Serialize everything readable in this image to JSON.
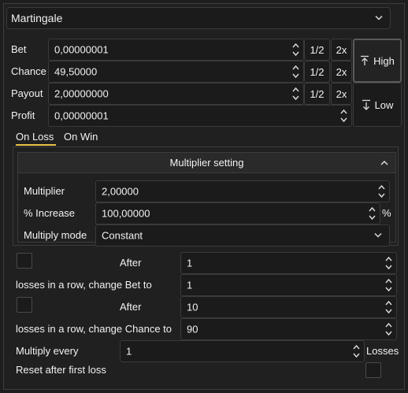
{
  "strategy": {
    "selected": "Martingale"
  },
  "bet": {
    "label": "Bet",
    "value": "0,00000001",
    "half": "1/2",
    "double": "2x"
  },
  "chance": {
    "label": "Chance",
    "value": "49,50000",
    "half": "1/2",
    "double": "2x"
  },
  "payout": {
    "label": "Payout",
    "value": "2,00000000",
    "half": "1/2",
    "double": "2x"
  },
  "profit": {
    "label": "Profit",
    "value": "0,00000001"
  },
  "high_button": {
    "label": "High"
  },
  "low_button": {
    "label": "Low"
  },
  "tabs": {
    "on_loss": "On Loss",
    "on_win": "On Win"
  },
  "multiplier_group": {
    "title": "Multiplier setting",
    "multiplier_label": "Multiplier",
    "multiplier_value": "2,00000",
    "increase_label": "% Increase",
    "increase_value": "100,00000",
    "increase_unit": "%",
    "mode_label": "Multiply mode",
    "mode_value": "Constant"
  },
  "rule1": {
    "after_label": "After",
    "after_value": "1",
    "text": "losses in a row, change Bet to",
    "value": "1"
  },
  "rule2": {
    "after_label": "After",
    "after_value": "10",
    "text": "losses in a row, change Chance to",
    "value": "90"
  },
  "multiply_every": {
    "label": "Multiply every",
    "value": "1",
    "unit": "Losses"
  },
  "reset": {
    "label": "Reset after first loss"
  },
  "colors": {
    "accent": "#e8c14a",
    "background": "#1e1e1e",
    "field": "#1b1b1b",
    "border": "#3a3a3a"
  }
}
